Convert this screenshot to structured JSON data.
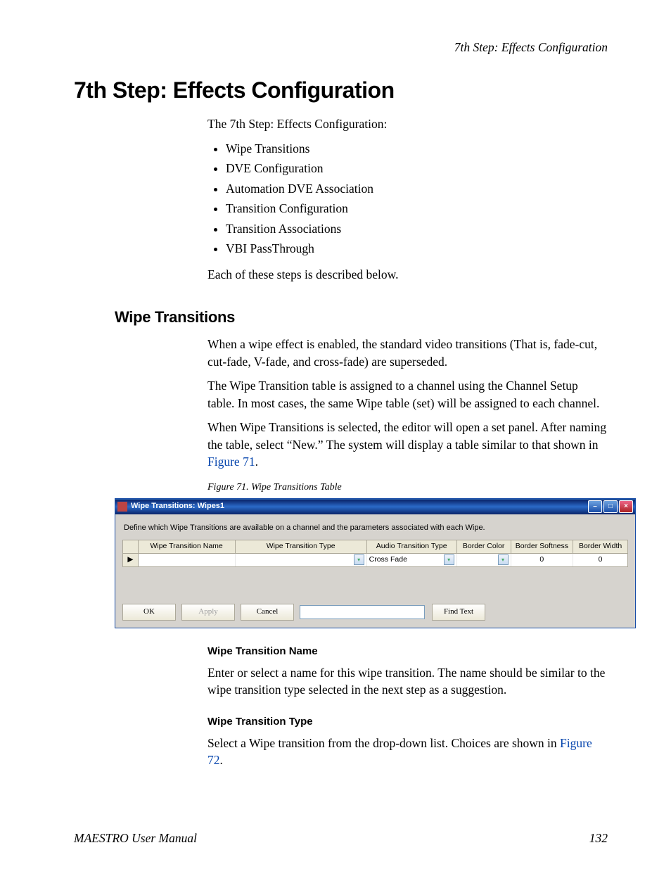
{
  "running_head": "7th Step: Effects Configuration",
  "h1": "7th Step: Effects Configuration",
  "intro": "The 7th Step: Effects Configuration:",
  "steps": [
    "Wipe Transitions",
    "DVE Configuration",
    "Automation DVE Association",
    "Transition Configuration",
    "Transition Associations",
    "VBI PassThrough"
  ],
  "intro_end": "Each of these steps is described below.",
  "h2": "Wipe Transitions",
  "p1": "When a wipe effect is enabled, the standard video transitions (That is, fade-cut, cut-fade, V-fade, and cross-fade) are superseded.",
  "p2": "The Wipe Transition table is assigned to a channel using the Channel Setup table. In most cases, the same Wipe table (set) will be assigned to each channel.",
  "p3a": "When Wipe Transitions is selected, the editor will open a set panel. After naming the table, select “New.” The system will display a table similar to that shown in ",
  "p3link": "Figure 71",
  "p3b": ".",
  "figcap": "Figure 71.  Wipe Transitions Table",
  "window": {
    "title": "Wipe Transitions: Wipes1",
    "desc": "Define which Wipe Transitions are available on a channel and the parameters associated with each Wipe.",
    "cols": [
      "Wipe Transition Name",
      "Wipe Transition Type",
      "Audio Transition Type",
      "Border Color",
      "Border Softness",
      "Border Width"
    ],
    "row_ptr": "▶",
    "audio_val": "Cross Fade",
    "softness_val": "0",
    "width_val": "0",
    "btn_ok": "OK",
    "btn_apply": "Apply",
    "btn_cancel": "Cancel",
    "btn_find": "Find Text",
    "min": "–",
    "max": "□",
    "close": "×",
    "dd": "▾"
  },
  "h3a": "Wipe Transition Name",
  "p4": "Enter or select a name for this wipe transition. The name should be similar to the wipe transition type selected in the next step as a suggestion.",
  "h3b": "Wipe Transition Type",
  "p5a": "Select a Wipe transition from the drop-down list. Choices are shown in ",
  "p5link": "Figure 72",
  "p5b": ".",
  "footer_left": "MAESTRO User Manual",
  "footer_right": "132"
}
